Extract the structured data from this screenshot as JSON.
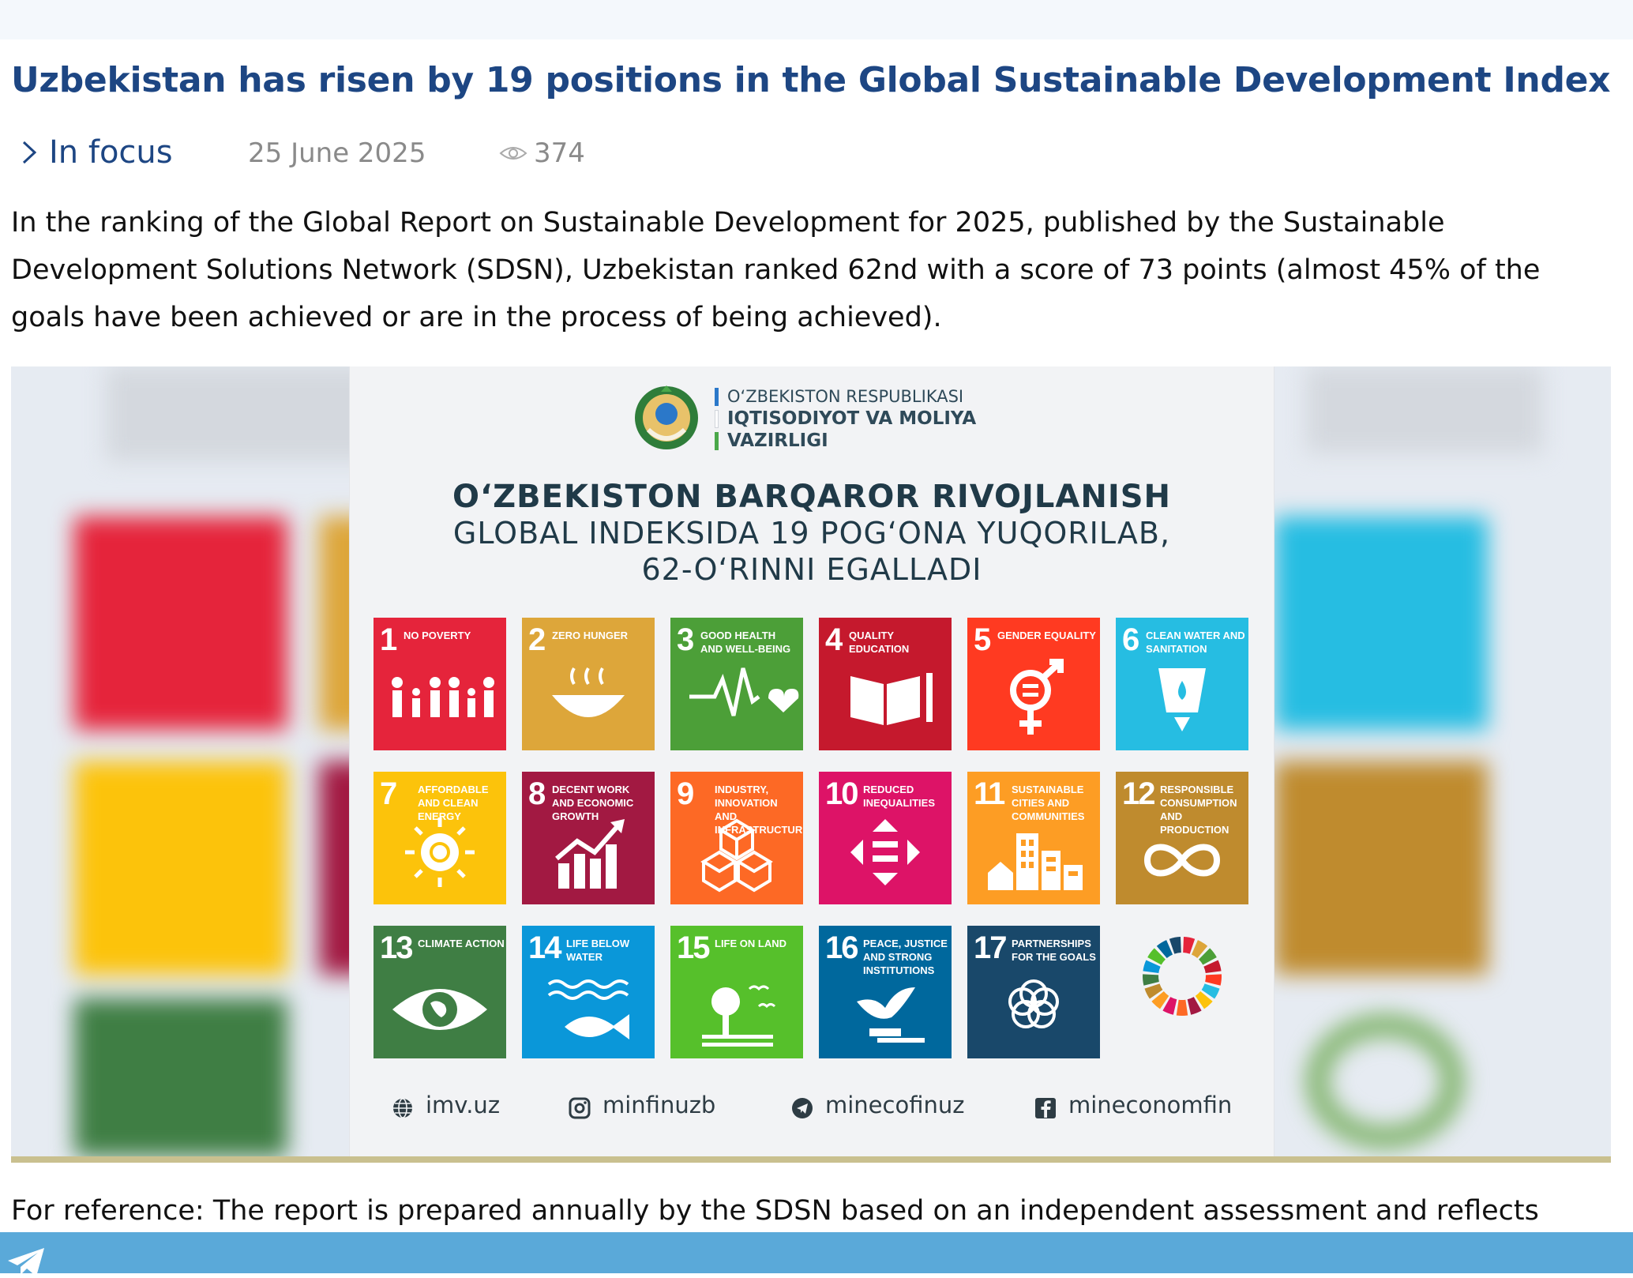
{
  "article": {
    "title": "Uzbekistan has risen by 19 positions in the Global Sustainable Development Index",
    "category": "In focus",
    "date": "25 June 2025",
    "views": "374",
    "lead": "In the ranking of the Global Report on Sustainable Development for 2025, published by the Sustainable Development Solutions Network (SDSN), Uzbekistan ranked 62nd with a score of 73 points (almost 45% of the goals have been achieved or are in the process of being achieved).",
    "note": "For reference: The report is prepared annually by the SDSN based on an independent assessment and reflects"
  },
  "poster": {
    "ministry_line1": "O‘ZBEKISTON RESPUBLIKASI",
    "ministry_line2": "IQTISODIYOT VA MOLIYA",
    "ministry_line3": "VAZIRLIGI",
    "headline_line1": "O‘ZBEKISTON BARQAROR RIVOJLANISH",
    "headline_line2": "GLOBAL INDEKSIDA 19 POG‘ONA YUQORILAB,",
    "headline_line3": "62-O‘RINNI EGALLADI",
    "goals": [
      {
        "num": "1",
        "label": "No poverty",
        "color": "#e5243b"
      },
      {
        "num": "2",
        "label": "Zero hunger",
        "color": "#dda63a"
      },
      {
        "num": "3",
        "label": "Good health and well-being",
        "color": "#4c9f38"
      },
      {
        "num": "4",
        "label": "Quality education",
        "color": "#c5192d"
      },
      {
        "num": "5",
        "label": "Gender equality",
        "color": "#ff3a21"
      },
      {
        "num": "6",
        "label": "Clean water and sanitation",
        "color": "#26bde2"
      },
      {
        "num": "7",
        "label": "Affordable and clean energy",
        "color": "#fcc30b"
      },
      {
        "num": "8",
        "label": "Decent work and economic growth",
        "color": "#a21942"
      },
      {
        "num": "9",
        "label": "Industry, innovation and infrastructure",
        "color": "#fd6925"
      },
      {
        "num": "10",
        "label": "Reduced inequalities",
        "color": "#dd1367"
      },
      {
        "num": "11",
        "label": "Sustainable cities and communities",
        "color": "#fd9d24"
      },
      {
        "num": "12",
        "label": "Responsible consumption and production",
        "color": "#bf8b2e"
      },
      {
        "num": "13",
        "label": "Climate action",
        "color": "#3f7e44"
      },
      {
        "num": "14",
        "label": "Life below water",
        "color": "#0a97d9"
      },
      {
        "num": "15",
        "label": "Life on land",
        "color": "#56c02b"
      },
      {
        "num": "16",
        "label": "Peace, justice and strong institutions",
        "color": "#00689d"
      },
      {
        "num": "17",
        "label": "Partnerships for the goals",
        "color": "#19486a"
      }
    ],
    "socials": [
      {
        "icon": "globe-icon",
        "text": "imv.uz"
      },
      {
        "icon": "instagram-icon",
        "text": "minfinuzb"
      },
      {
        "icon": "telegram-icon",
        "text": "minecofinuz"
      },
      {
        "icon": "facebook-icon",
        "text": "mineconomfin"
      }
    ]
  },
  "colors": {
    "title": "#1d4683",
    "meta_gray": "#8a8a8a",
    "share_bar": "#5aa9d9",
    "media_rule": "#c9c08f"
  }
}
